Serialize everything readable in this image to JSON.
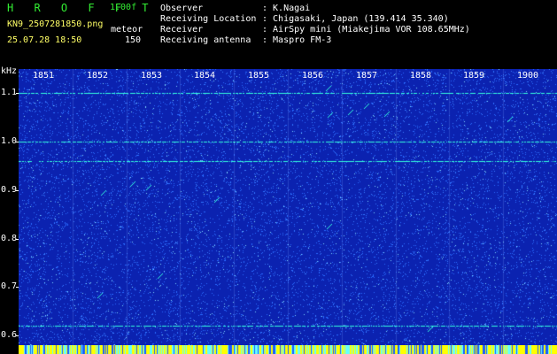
{
  "app": {
    "brand": "H R O F F T",
    "version": "1.00f",
    "filename": "KN9_2507281850.png",
    "datetime": "25.07.28 18:50",
    "mode_label": "meteor",
    "mode_value": "150"
  },
  "info": {
    "rows": [
      {
        "label": "Observer",
        "value": "K.Nagai"
      },
      {
        "label": "Receiving Location",
        "value": "Chigasaki, Japan (139.414 35.340)"
      },
      {
        "label": "Receiver",
        "value": "AirSpy mini (Miakejima VOR 108.65MHz)"
      },
      {
        "label": "Receiving antenna",
        "value": "Maspro FM-3"
      }
    ]
  },
  "spectrogram": {
    "y_unit": "kHz",
    "y_ticks": [
      "1.1",
      "1.0",
      "0.9",
      "0.8",
      "0.7",
      "0.6"
    ],
    "y_range": [
      0.58,
      1.15
    ],
    "x_ticks": [
      "1851",
      "1852",
      "1853",
      "1854",
      "1855",
      "1856",
      "1857",
      "1858",
      "1859",
      "1900"
    ],
    "colors": {
      "background": "#0b22b0",
      "noise": "#2a6bff",
      "signal": "#33ffdd",
      "footer": "#ffff00"
    },
    "carrier_lines_khz": [
      1.1,
      1.0,
      0.96,
      0.62
    ]
  }
}
